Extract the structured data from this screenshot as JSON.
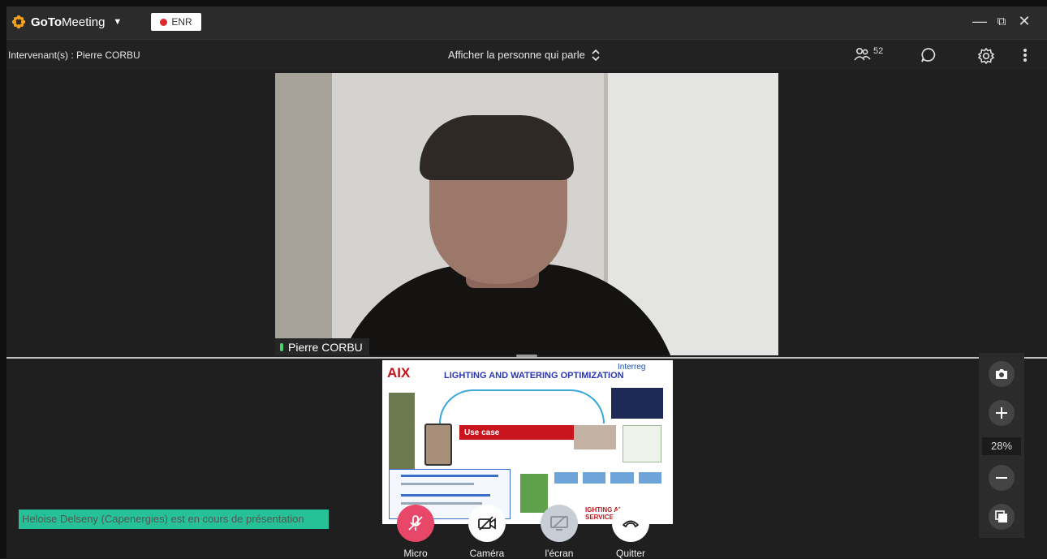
{
  "titlebar": {
    "app_name_bold": "GoTo",
    "app_name_rest": "Meeting",
    "recording_label": "ENR"
  },
  "infobar": {
    "speaker_label": "Intervenant(s) : Pierre CORBU",
    "view_mode": "Afficher la personne qui parle",
    "participant_count": "52"
  },
  "video": {
    "speaker_name": "Pierre CORBU"
  },
  "slide": {
    "logo_text": "AIX",
    "title": "LIGHTING AND WATERING OPTIMIZATION",
    "partner": "Interreg",
    "use_case_label": "Use case",
    "footer_text_1": "IGHTING AND",
    "footer_text_2": "SERVICE"
  },
  "presenting_banner": "Heloise Delseny (Capenergies) est en cours de présentation",
  "toolbar": {
    "micro": "Micro",
    "camera": "Caméra",
    "screen": "l'écran",
    "quit": "Quitter"
  },
  "zoom": {
    "level": "28%"
  },
  "colors": {
    "accent_orange": "#f7a21b",
    "mic_muted_red": "#e8476a",
    "banner_green": "#26c196",
    "record_red": "#e0292e"
  }
}
